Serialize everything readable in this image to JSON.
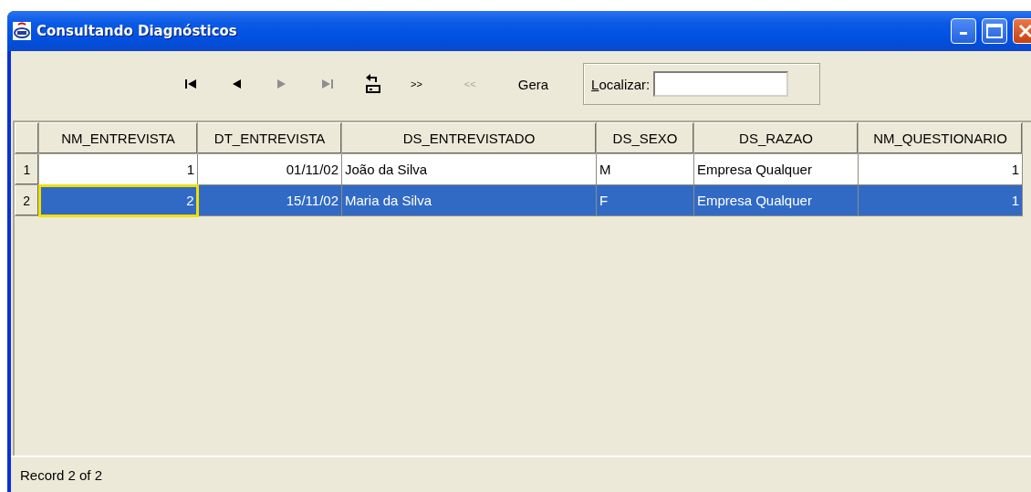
{
  "window": {
    "title": "Consultando Diagnósticos"
  },
  "toolbar": [
    {
      "kind": "first",
      "disabled": false
    },
    {
      "kind": "previous",
      "disabled": false
    },
    {
      "kind": "next",
      "disabled": true
    },
    {
      "kind": "last",
      "disabled": true
    },
    {
      "kind": "refresh",
      "disabled": false
    },
    {
      "kind": "text",
      "label": ">>",
      "disabled": false
    },
    {
      "kind": "text",
      "label": "<<",
      "disabled": true
    },
    {
      "kind": "text",
      "label": "Gera",
      "disabled": false
    }
  ],
  "search": {
    "label": "Localizar:"
  },
  "table": {
    "columns": [
      {
        "label": "NM_ENTREVISTA"
      },
      {
        "label": "DT_ENTREVISTA"
      },
      {
        "label": "DS_ENTREVISTADO"
      },
      {
        "label": "DS_SEXO"
      },
      {
        "label": "DS_RAZAO"
      },
      {
        "label": "NM_QUESTIONARIO"
      }
    ],
    "rows": [
      {
        "number": "1",
        "selected": false,
        "cells": [
          {
            "text": "1",
            "focused": false
          },
          {
            "text": "01/11/02",
            "focused": false
          },
          {
            "text": "João da Silva",
            "focused": false
          },
          {
            "text": "M",
            "focused": false
          },
          {
            "text": "Empresa Qualquer",
            "focused": false
          },
          {
            "text": "1",
            "focused": false
          }
        ]
      },
      {
        "number": "2",
        "selected": true,
        "cells": [
          {
            "text": "2",
            "focused": true
          },
          {
            "text": "15/11/02",
            "focused": false
          },
          {
            "text": "Maria da Silva",
            "focused": false
          },
          {
            "text": "F",
            "focused": false
          },
          {
            "text": "Empresa Qualquer",
            "focused": false
          },
          {
            "text": "1",
            "focused": false
          }
        ]
      }
    ]
  },
  "status_bar": {
    "text": "Record 2 of 2"
  }
}
